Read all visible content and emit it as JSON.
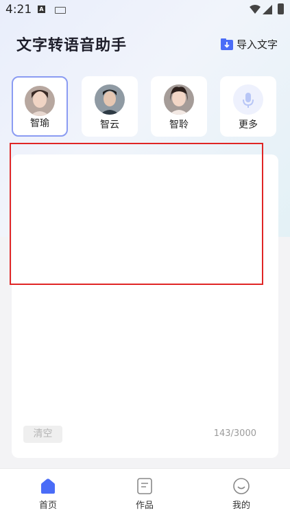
{
  "status_bar": {
    "time": "4:21"
  },
  "header": {
    "title": "文字转语音助手",
    "import_label": "导入文字"
  },
  "voices": [
    {
      "name": "智瑜",
      "selected": true
    },
    {
      "name": "智云",
      "selected": false
    },
    {
      "name": "智聆",
      "selected": false
    },
    {
      "name": "更多",
      "selected": false
    }
  ],
  "editor": {
    "clear_label": "清空",
    "char_count": "143/3000"
  },
  "nav": [
    {
      "label": "首页",
      "active": true
    },
    {
      "label": "作品",
      "active": false
    },
    {
      "label": "我的",
      "active": false
    }
  ],
  "colors": {
    "accent": "#4a6cf7",
    "highlight": "#e02525",
    "selected_border": "#8a9bf2"
  }
}
